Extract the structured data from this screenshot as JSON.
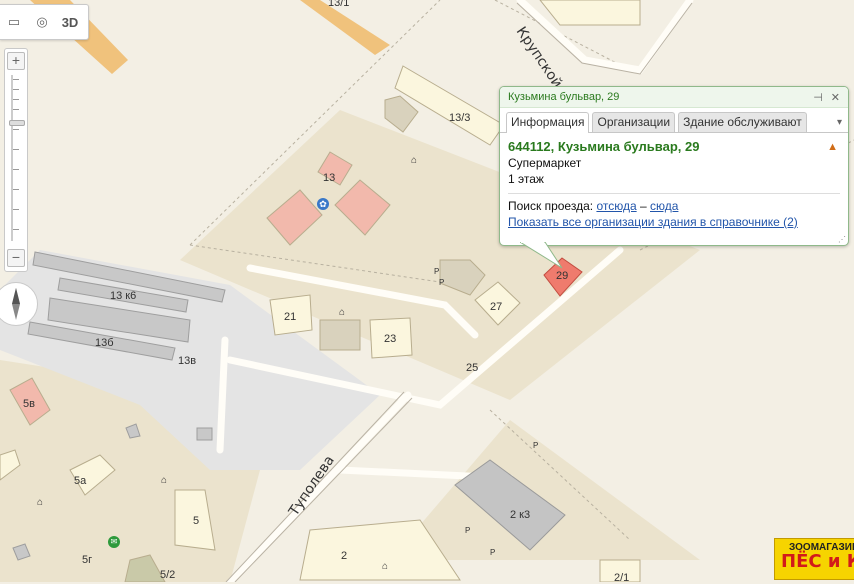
{
  "toolbar": {
    "ruler_icon": "ruler-icon",
    "traffic_icon": "traffic-icon",
    "label_3d": "3D"
  },
  "zoom": {
    "plus": "+",
    "minus": "−",
    "level": 0.27
  },
  "map": {
    "building_labels": [
      "13/1",
      "13/3",
      "13",
      "13 к6",
      "13б",
      "13в",
      "21",
      "23",
      "27",
      "29",
      "25",
      "5в",
      "5а",
      "5",
      "5г",
      "5/2",
      "2",
      "2 к3",
      "2/1"
    ],
    "street_labels": [
      "Крупской",
      "Туполева"
    ],
    "parking_label": "P",
    "colors": {
      "background": "#f3efe4",
      "block": "#ebe3cd",
      "building": "#fbf6de",
      "building_pink": "#f2b9ac",
      "selected": "#ef7b6d",
      "industrial": "#e4e4e4"
    }
  },
  "balloon": {
    "title": "Кузьмина бульвар, 29",
    "tabs": [
      "Информация",
      "Организации",
      "Здание обслуживают"
    ],
    "address": "644112, Кузьмина бульвар, 29",
    "type": "Супермаркет",
    "floors": "1 этаж",
    "route_label": "Поиск проезда:",
    "route_from": "отсюда",
    "route_dash": "–",
    "route_to": "сюда",
    "orgs_link": "Показать все организации здания в справочнике (2)"
  },
  "ad": {
    "top": "ЗООМАГАЗИН",
    "main": "ПЁС и КО"
  }
}
